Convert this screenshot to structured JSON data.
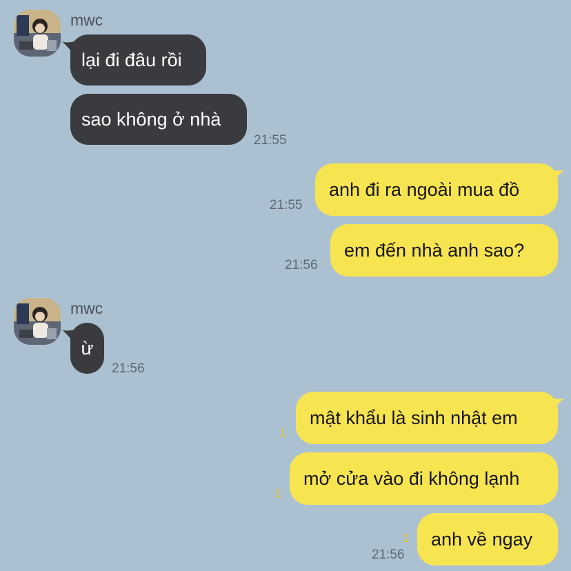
{
  "theme": {
    "background": "#abc1d1",
    "incoming_bubble": "#3a3b3e",
    "outgoing_bubble": "#f7e451",
    "unread_color": "#e8c92b"
  },
  "messages": [
    {
      "sender": "mwc",
      "avatar": "avatar-photo",
      "text": "lại đi đâu rồi"
    },
    {
      "text": "sao không ở nhà",
      "time": "21:55"
    },
    {
      "text": "anh đi ra ngoài mua đồ",
      "time": "21:55"
    },
    {
      "text": "em đến nhà anh sao?",
      "time": "21:56"
    },
    {
      "sender": "mwc",
      "avatar": "avatar-photo",
      "text": "ừ",
      "time": "21:56"
    },
    {
      "text": "mật khẩu là sinh nhật em",
      "unread": "1"
    },
    {
      "text": "mở cửa vào đi không lạnh",
      "unread": "1"
    },
    {
      "text": "anh về ngay",
      "unread": "1",
      "time": "21:56"
    }
  ]
}
